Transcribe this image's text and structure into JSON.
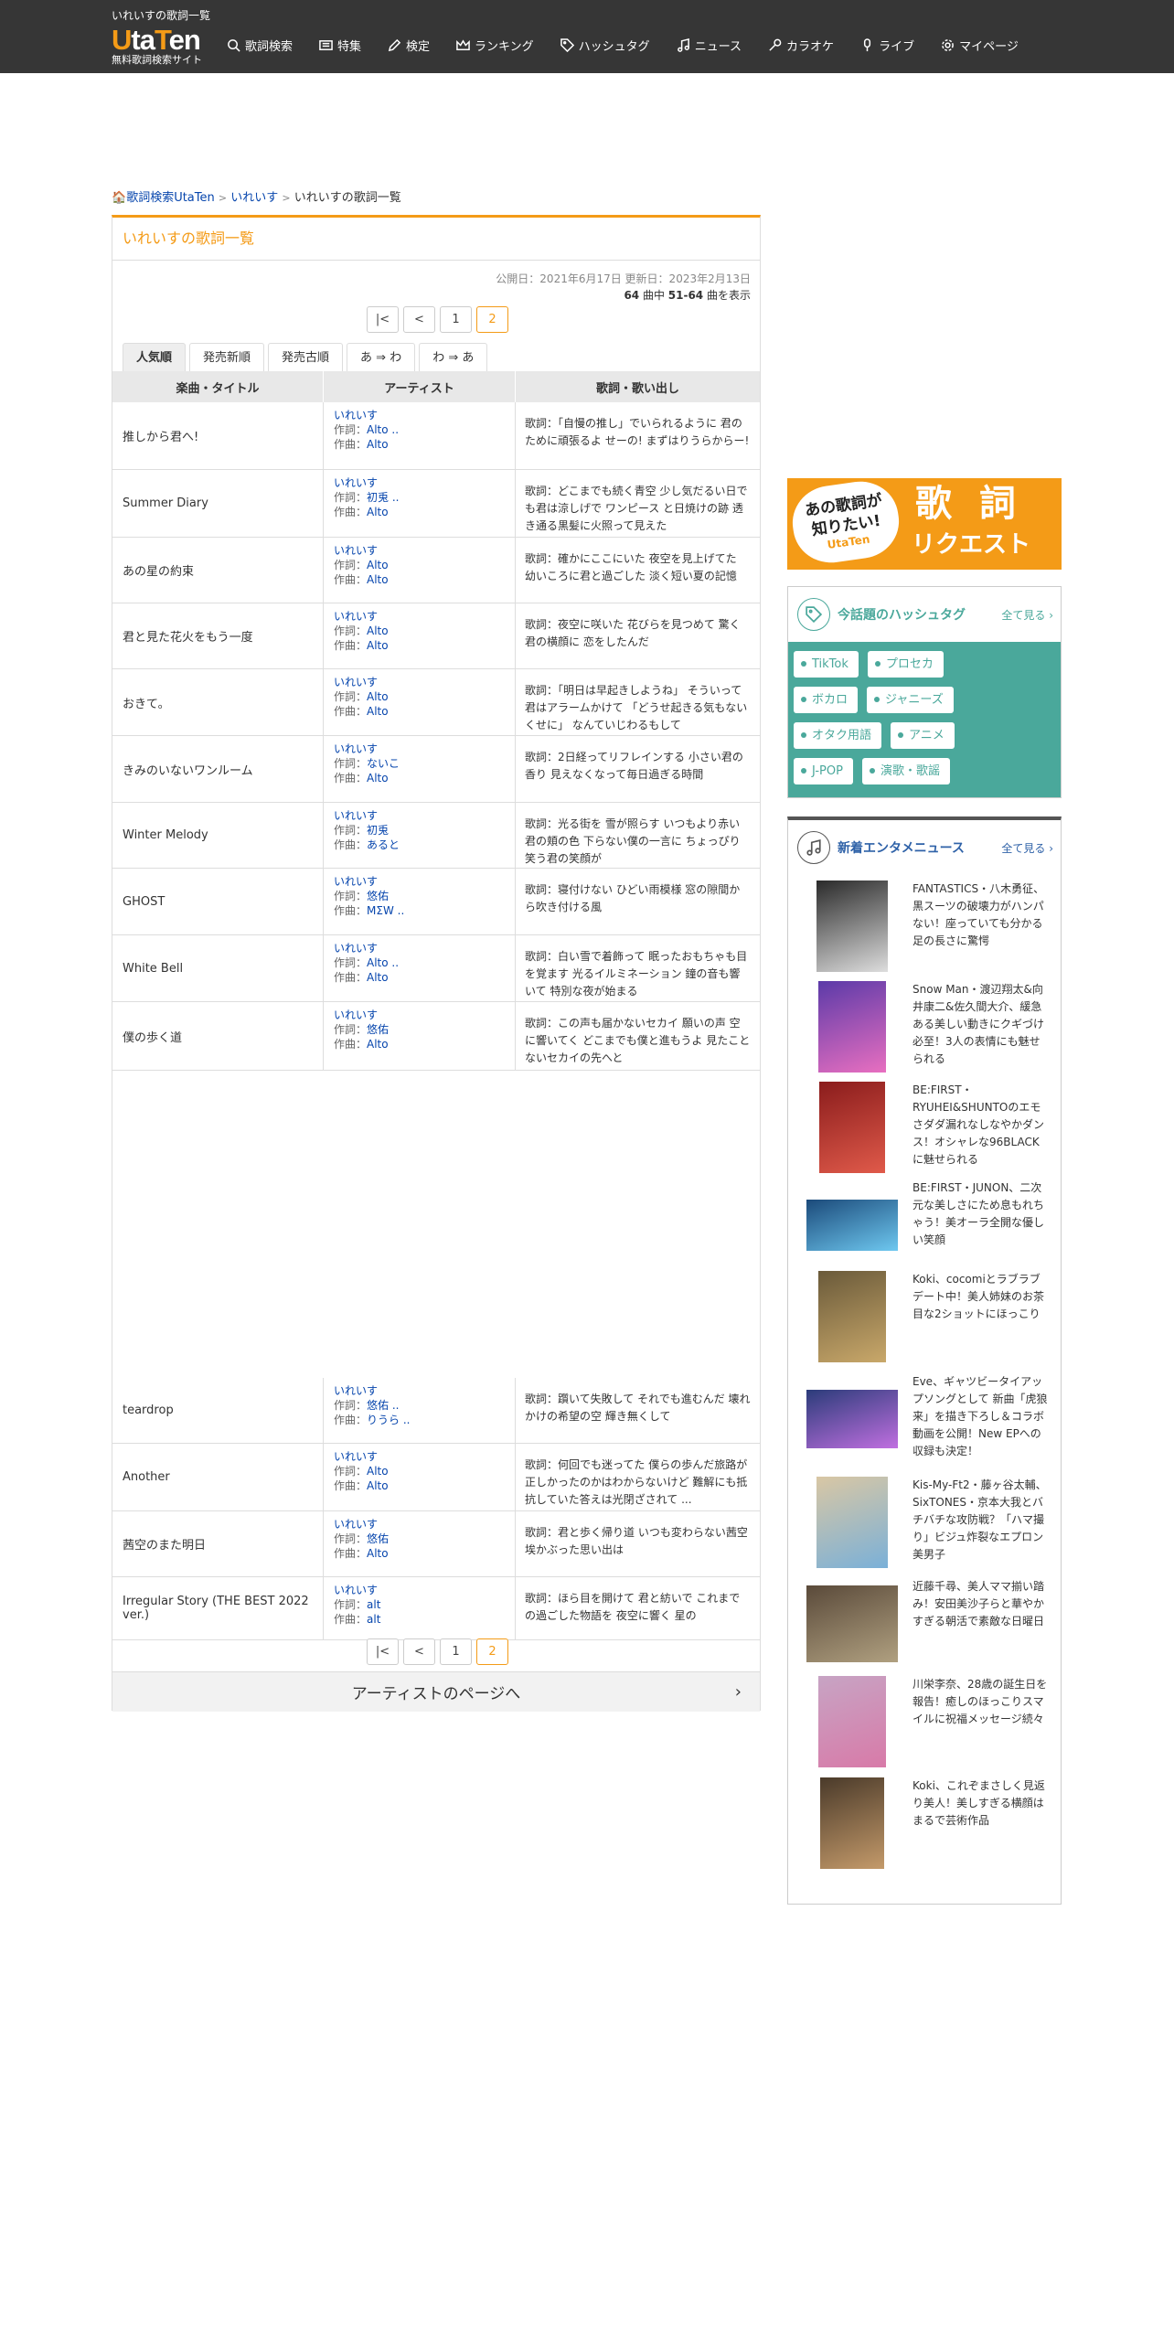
{
  "header": {
    "site_desc": "いれいすの歌詞一覧",
    "logo_u": "U",
    "logo_ta": "ta",
    "logo_t": "T",
    "logo_en": "en",
    "logo_sub": "無料歌詞検索サイト",
    "nav": [
      {
        "label": "歌詞検索",
        "icon": "search-icon"
      },
      {
        "label": "特集",
        "icon": "feature-icon"
      },
      {
        "label": "検定",
        "icon": "pencil-icon"
      },
      {
        "label": "ランキング",
        "icon": "crown-icon"
      },
      {
        "label": "ハッシュタグ",
        "icon": "tag-icon"
      },
      {
        "label": "ニュース",
        "icon": "music-note-icon"
      },
      {
        "label": "カラオケ",
        "icon": "mic-icon"
      },
      {
        "label": "ライブ",
        "icon": "live-icon"
      },
      {
        "label": "マイページ",
        "icon": "gear-icon"
      }
    ]
  },
  "breadcrumb": {
    "home": "歌詞検索UtaTen",
    "artist": "いれいす",
    "current": "いれいすの歌詞一覧"
  },
  "main": {
    "title": "いれいすの歌詞一覧",
    "dates": "公開日：2021年6月17日 更新日：2023年2月13日",
    "count_total": "64",
    "count_mid": " 曲中 ",
    "count_range": "51-64",
    "count_tail": " 曲を表示",
    "pager": {
      "first": "|<",
      "prev": "<",
      "p1": "1",
      "p2": "2"
    },
    "tabs": [
      "人気順",
      "発売新順",
      "発売古順",
      "あ ⇒ わ",
      "わ ⇒ あ"
    ],
    "columns": [
      "楽曲・タイトル",
      "アーティスト",
      "歌詞・歌い出し"
    ],
    "lyric_label": "作詞：",
    "music_label": "作曲：",
    "songs": [
      {
        "title": "推しから君へ!",
        "artist": "いれいす",
        "lyricist": "Alto ..",
        "composer": "Alto",
        "lyric": "歌詞：「自慢の推し」でいられるように 君のために頑張るよ せーの! まずはりうらからー!"
      },
      {
        "title": "Summer Diary",
        "artist": "いれいす",
        "lyricist": "初兎 ..",
        "composer": "Alto",
        "lyric": "歌詞：どこまでも続く青空 少し気だるい日でも君は涼しげで ワンピース と日焼けの跡 透き通る黒髪に火照って見えた"
      },
      {
        "title": "あの星の約束",
        "artist": "いれいす",
        "lyricist": "Alto",
        "composer": "Alto",
        "lyric": "歌詞：確かにここにいた 夜空を見上げてた 幼いころに君と過ごした 淡く短い夏の記憶"
      },
      {
        "title": "君と見た花火をもう一度",
        "artist": "いれいす",
        "lyricist": "Alto",
        "composer": "Alto",
        "lyric": "歌詞：夜空に咲いた 花びらを見つめて 驚く君の横顔に 恋をしたんだ"
      },
      {
        "title": "おきて。",
        "artist": "いれいす",
        "lyricist": "Alto",
        "composer": "Alto",
        "lyric": "歌詞：「明日は早起きしようね」 そういって君はアラームかけて 「どうせ起きる気もないくせに」 なんていじわるもして"
      },
      {
        "title": "きみのいないワンルーム",
        "artist": "いれいす",
        "lyricist": "ないこ",
        "composer": "Alto",
        "lyric": "歌詞：2日経ってリフレインする 小さい君の香り 見えなくなって毎日過ぎる時間"
      },
      {
        "title": "Winter Melody",
        "artist": "いれいす",
        "lyricist": "初兎",
        "composer": "あると",
        "lyric": "歌詞：光る街を 雪が照らす いつもより赤い君の頬の色 下らない僕の一言に ちょっぴり笑う君の笑顔が"
      },
      {
        "title": "GHOST",
        "artist": "いれいす",
        "lyricist": "悠佑",
        "composer": "MΣW ..",
        "lyric": "歌詞：寝付けない ひどい雨模様 窓の隙間から吹き付ける風"
      },
      {
        "title": "White Bell",
        "artist": "いれいす",
        "lyricist": "Alto ..",
        "composer": "Alto",
        "lyric": "歌詞：白い雪で着飾って 眠ったおもちゃも目を覚ます 光るイルミネーション 鐘の音も響いて 特別な夜が始まる"
      },
      {
        "title": "僕の歩く道",
        "artist": "いれいす",
        "lyricist": "悠佑",
        "composer": "Alto",
        "lyric": "歌詞：この声も届かないセカイ 願いの声 空に響いてく どこまでも僕と進もうよ 見たことないセカイの先へと"
      },
      {
        "title": "teardrop",
        "artist": "いれいす",
        "lyricist": "悠佑 ..",
        "composer": "りうら ..",
        "lyric": "歌詞：躓いて失敗して それでも進むんだ 壊れかけの希望の空 輝き無くして"
      },
      {
        "title": "Another",
        "artist": "いれいす",
        "lyricist": "Alto",
        "composer": "Alto",
        "lyric": "歌詞：何回でも迷ってた 僕らの歩んだ旅路が 正しかったのかはわからないけど 難解にも抵抗していた答えは光閉ざされて ..."
      },
      {
        "title": "茜空のまた明日",
        "artist": "いれいす",
        "lyricist": "悠佑",
        "composer": "Alto",
        "lyric": "歌詞：君と歩く帰り道 いつも変わらない茜空 埃かぶった思い出は"
      },
      {
        "title": "Irregular Story (THE BEST 2022 ver.)",
        "artist": "いれいす",
        "lyricist": "alt",
        "composer": "alt",
        "lyric": "歌詞：ほら目を開けて 君と紡いで これまでの過ごした物語を 夜空に響く 星の"
      }
    ],
    "artist_page": "アーティストのページへ"
  },
  "side": {
    "banner_q1": "あの歌詞が",
    "banner_q2": "知りたい!",
    "banner_logo": "UtaTen",
    "banner_big": "歌 詞",
    "banner_req": "リクエスト",
    "hashtag_title": "今話題のハッシュタグ",
    "more": "全て見る",
    "hashtags": [
      [
        "TikTok",
        "プロセカ"
      ],
      [
        "ボカロ",
        "ジャニーズ"
      ],
      [
        "オタク用語",
        "アニメ"
      ],
      [
        "J-POP",
        "演歌・歌謡"
      ]
    ],
    "news_title": "新着エンタメニュース",
    "news": [
      "FANTASTICS・八木勇征、黒スーツの破壊力がハンパない！座っていても分かる足の長さに驚愕",
      "Snow Man・渡辺翔太&向井康二&佐久間大介、緩急ある美しい動きにクギづけ必至！3人の表情にも魅せられる",
      "BE:FIRST・RYUHEI&SHUNTOのエモさダダ漏れなしなやかダンス！オシャレな96BLACKに魅せられる",
      "BE:FIRST・JUNON、二次元な美しさにため息もれちゃう！美オーラ全開な優しい笑顔",
      "Koki、cocomiとラブラブデート中！美人姉妹のお茶目な2ショットにほっこり",
      "Eve、ギャツビータイアップソングとして 新曲「虎狼来」を描き下ろし＆コラボ動画を公開！New EPへの収録も決定！",
      "Kis-My-Ft2・藤ヶ谷太輔、SixTONES・京本大我とバチバチな攻防戦？「ハマ撮り」ビジュ炸裂なエプロン美男子",
      "近藤千尋、美人ママ揃い踏み！安田美沙子らと華やかすぎる朝活で素敵な日曜日",
      "川栄李奈、28歳の誕生日を報告！癒しのほっこりスマイルに祝福メッセージ続々",
      "Koki、これぞまさしく見返り美人！美しすぎる横顔はまるで芸術作品"
    ]
  },
  "colors": {
    "accent": "#f49b17",
    "teal": "#4aa89b",
    "header": "#363636",
    "link": "#0645ad"
  }
}
